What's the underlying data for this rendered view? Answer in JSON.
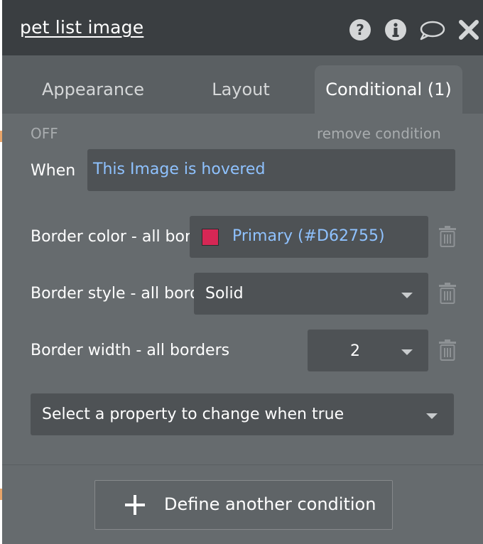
{
  "panel": {
    "title": "pet list image",
    "header_icons": [
      "help-icon",
      "info-icon",
      "comment-icon",
      "close-icon"
    ]
  },
  "tabs": [
    {
      "label": "Appearance",
      "active": false
    },
    {
      "label": "Layout",
      "active": false
    },
    {
      "label": "Conditional (1)",
      "active": true
    }
  ],
  "condition": {
    "state_label": "OFF",
    "remove_label": "remove condition",
    "when_label": "When",
    "when_expression": "This Image is hovered",
    "properties": [
      {
        "label": "Border color - all borders",
        "value": "Primary (#D62755)",
        "swatch": "#D62755",
        "delete_icon": "trash-icon"
      },
      {
        "label": "Border style - all borders",
        "value": "Solid",
        "delete_icon": "trash-icon"
      },
      {
        "label": "Border width - all borders",
        "value": "2",
        "delete_icon": "trash-icon"
      }
    ],
    "select_property_placeholder": "Select a property to change when true"
  },
  "actions": {
    "define_another_label": "Define another condition"
  },
  "colors": {
    "header_bg": "#3a3e41",
    "panel_bg": "#666b6e",
    "field_bg": "#4e5255",
    "link": "#8fc2ff",
    "primary_swatch": "#D62755"
  }
}
